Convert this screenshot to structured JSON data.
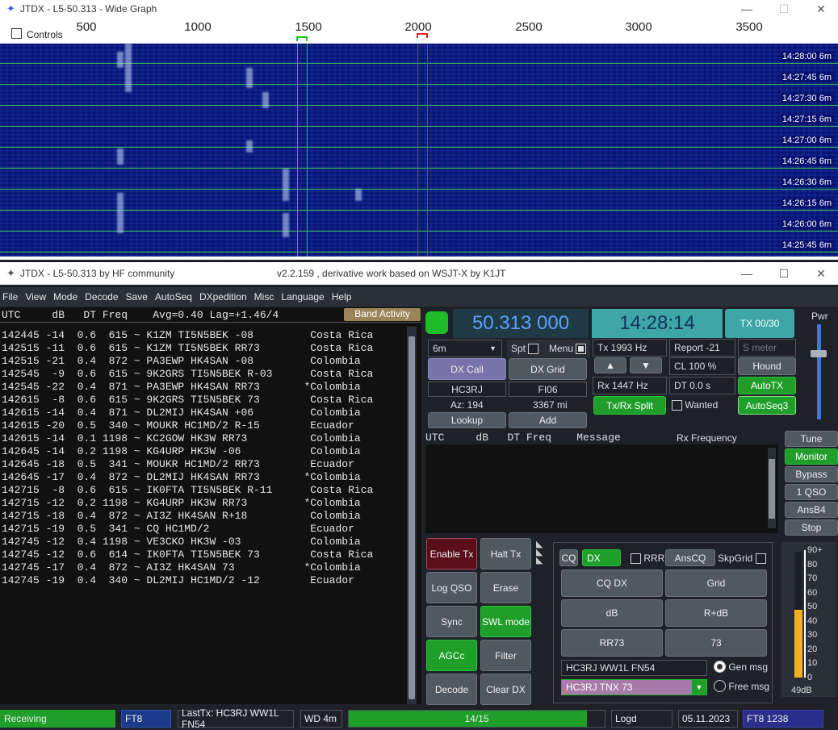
{
  "graph": {
    "title": "JTDX - L5-50.313 - Wide Graph",
    "controls": "Controls",
    "ticks": [
      "500",
      "1000",
      "1500",
      "2000",
      "2500",
      "3000",
      "3500"
    ],
    "times": [
      "14:28:00",
      "14:27:45",
      "14:27:30",
      "14:27:15",
      "14:27:00",
      "14:26:45",
      "14:26:30",
      "14:26:15",
      "14:26:00",
      "14:25:45"
    ],
    "band": "6m"
  },
  "main": {
    "title": "JTDX - L5-50.313  by HF community",
    "subtitle": "v2.2.159 , derivative work based on WSJT-X by K1JT"
  },
  "menu": [
    "File",
    "View",
    "Mode",
    "Decode",
    "Save",
    "AutoSeq",
    "DXpedition",
    "Misc",
    "Language",
    "Help"
  ],
  "decode_header": "UTC     dB   DT Freq    Avg=0.40 Lag=+1.46/4",
  "band_activity": "Band Activity",
  "decodes": [
    "142445 -14  0.6  615 ~ K1ZM TI5N5BEK -08         Costa Rica",
    "142515 -11  0.6  615 ~ K1ZM TI5N5BEK RR73        Costa Rica",
    "142515 -21  0.4  872 ~ PA3EWP HK4SAN -08         Colombia",
    "142545  -9  0.6  615 ~ 9K2GRS TI5N5BEK R-03      Costa Rica",
    "142545 -22  0.4  871 ~ PA3EWP HK4SAN RR73       *Colombia",
    "142615  -8  0.6  615 ~ 9K2GRS TI5N5BEK 73        Costa Rica",
    "142615 -14  0.4  871 ~ DL2MIJ HK4SAN +06         Colombia",
    "142615 -20  0.5  340 ~ MOUKR HC1MD/2 R-15        Ecuador",
    "142615 -14  0.1 1198 ~ KC2GOW HK3W RR73          Colombia",
    "142645 -14  0.2 1198 ~ KG4URP HK3W -06           Colombia",
    "142645 -18  0.5  341 ~ MOUKR HC1MD/2 RR73        Ecuador",
    "142645 -17  0.4  872 ~ DL2MIJ HK4SAN RR73       *Colombia",
    "142715  -8  0.6  615 ~ IK0FTA TI5N5BEK R-11      Costa Rica",
    "142715 -12  0.2 1198 ~ KG4URP HK3W RR73         *Colombia",
    "142715 -18  0.4  872 ~ AI3Z HK4SAN R+18          Colombia",
    "142715 -19  0.5  341 ~ CQ HC1MD/2                Ecuador",
    "142745 -12  0.4 1198 ~ VE3CKO HK3W -03           Colombia",
    "142745 -12  0.6  614 ~ IK0FTA TI5N5BEK 73        Costa Rica",
    "142745 -17  0.4  872 ~ AI3Z HK4SAN 73           *Colombia",
    "142745 -19  0.4  340 ~ DL2MIJ HC1MD/2 -12        Ecuador"
  ],
  "freq": "50.313 000",
  "clock": "14:28:14",
  "tx_period": "TX 00/30",
  "pwr": "Pwr",
  "band_sel": "6m",
  "spt": "Spt",
  "menu_cb": "Menu",
  "tx_hz": "Tx  1993  Hz",
  "report": "Report -21",
  "smeter": "S meter",
  "dx_call_btn": "DX Call",
  "dx_grid_btn": "DX Grid",
  "dx_call": "HC3RJ",
  "dx_grid": "FI06",
  "az": "Az: 194",
  "dist": "3367 mi",
  "lookup": "Lookup",
  "add": "Add",
  "up": "▲",
  "down": "▼",
  "cl": "CL  100 %",
  "hound": "Hound",
  "rx_hz": "Rx  1447  Hz",
  "dt": "DT 0.0 s",
  "autotx": "AutoTX",
  "split": "Tx/Rx Split",
  "wanted": "Wanted",
  "autoseq3": "AutoSeq3",
  "rx_header": "UTC     dB   DT Freq    Message",
  "rx_freq": "Rx Frequency",
  "side": [
    "Tune",
    "Monitor",
    "Bypass",
    "1 QSO",
    "AnsB4",
    "Stop"
  ],
  "ctrl": [
    "Enable Tx",
    "Halt Tx",
    "Log QSO",
    "Erase",
    "Sync",
    "SWL mode",
    "AGCc",
    "Filter",
    "Decode",
    "Clear DX"
  ],
  "cq": "CQ",
  "dx": "DX",
  "rrr": "RRR",
  "anscq": "AnsCQ",
  "skpgrid": "SkpGrid",
  "msgbtns": [
    "CQ DX",
    "Grid",
    "dB",
    "R+dB",
    "RR73",
    "73"
  ],
  "genmsg_text": "HC3RJ WW1L FN54",
  "genmsg": "Gen msg",
  "freemsg_text": "HC3RJ TNX 73",
  "freemsg": "Free msg",
  "meter_labels": [
    "90+",
    "80",
    "70",
    "60",
    "50",
    "40",
    "30",
    "20",
    "10",
    "0"
  ],
  "meter_db": "49dB",
  "meter_level": 0.54,
  "status": {
    "state": "Receiving",
    "mode": "FT8",
    "lasttx": "LastTx: HC3RJ WW1L FN54",
    "wd": "WD 4m",
    "progress": "14/15",
    "progress_value": 0.93,
    "logd": "Logd",
    "date": "05.11.2023",
    "mode2": "FT8  1238"
  }
}
